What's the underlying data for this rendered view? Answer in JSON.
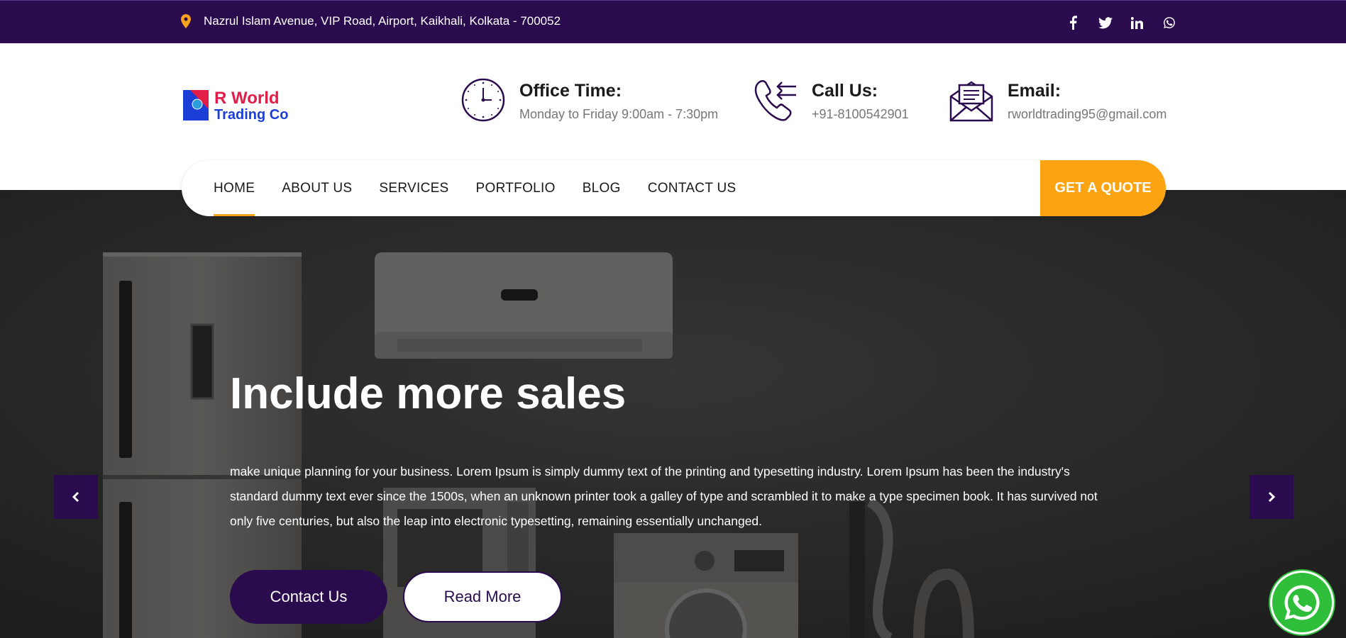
{
  "topbar": {
    "address": "Nazrul Islam Avenue, VIP Road, Airport, Kaikhali, Kolkata - 700052",
    "social_icons": [
      "facebook-icon",
      "twitter-icon",
      "linkedin-icon",
      "whatsapp-icon"
    ]
  },
  "logo": {
    "line1": "R World",
    "line2": "Trading Co"
  },
  "info": {
    "office": {
      "title": "Office Time:",
      "value": "Monday to Friday 9:00am - 7:30pm"
    },
    "call": {
      "title": "Call Us:",
      "value": "+91-8100542901"
    },
    "email": {
      "title": "Email:",
      "value": "rworldtrading95@gmail.com"
    }
  },
  "nav": {
    "items": [
      "HOME",
      "ABOUT US",
      "SERVICES",
      "PORTFOLIO",
      "BLOG",
      "CONTACT US"
    ],
    "active": "HOME",
    "quote_label": "GET A QUOTE"
  },
  "hero": {
    "title": "Include more sales",
    "description": "make unique planning for your business. Lorem Ipsum is simply dummy text of the printing and typesetting industry. Lorem Ipsum has been the industry's standard dummy text ever since the 1500s, when an unknown printer took a galley of type and scrambled it to make a type specimen book. It has survived not only five centuries, but also the leap into electronic typesetting, remaining essentially unchanged.",
    "contact_label": "Contact Us",
    "read_more_label": "Read More"
  },
  "colors": {
    "brand_purple": "#2a0b4d",
    "accent_orange": "#fca312",
    "whatsapp_green": "#2fbe3a"
  }
}
